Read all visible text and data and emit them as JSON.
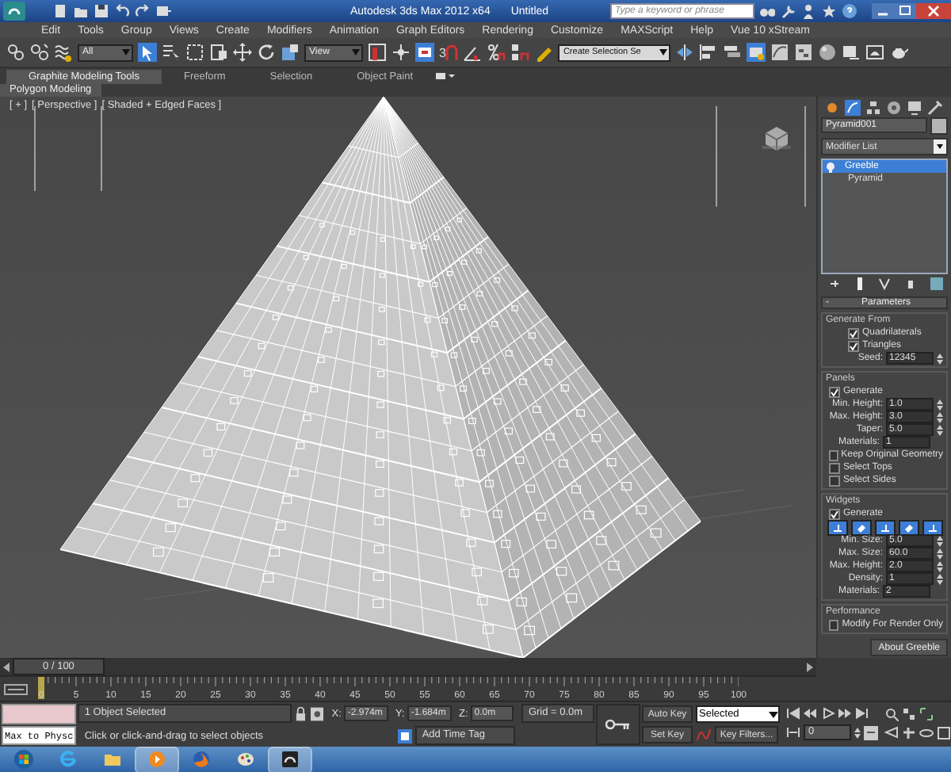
{
  "window": {
    "title": "Autodesk 3ds Max 2012 x64",
    "document": "Untitled",
    "search_placeholder": "Type a keyword or phrase"
  },
  "menu": [
    "Edit",
    "Tools",
    "Group",
    "Views",
    "Create",
    "Modifiers",
    "Animation",
    "Graph Editors",
    "Rendering",
    "Customize",
    "MAXScript",
    "Help",
    "Vue 10 xStream"
  ],
  "toolbar": {
    "selection_filter": "All",
    "reference_coordinate": "View",
    "snap_toggle": "3",
    "named_selection": "Create Selection Se"
  },
  "ribbon": {
    "tabs": [
      {
        "label": "Graphite Modeling Tools",
        "selected": true
      },
      {
        "label": "Freeform",
        "selected": false
      },
      {
        "label": "Selection",
        "selected": false
      },
      {
        "label": "Object Paint",
        "selected": false
      }
    ],
    "panel": "Polygon Modeling"
  },
  "viewport": {
    "labels": [
      "[ + ]",
      "[ Perspective ]",
      "[ Shaded + Edged Faces ]"
    ]
  },
  "command_panel": {
    "object_name": "Pyramid001",
    "modifier_list": "Modifier List",
    "stack": [
      {
        "label": "Greeble",
        "selected": true
      },
      {
        "label": "Pyramid",
        "selected": false
      }
    ],
    "rollout": {
      "toggle": "-",
      "title": "Parameters"
    },
    "groups": [
      {
        "title": "Generate From",
        "rows": [
          {
            "kind": "checkbox",
            "label": "Quadrilaterals",
            "checked": true
          },
          {
            "kind": "checkbox",
            "label": "Triangles",
            "checked": true
          },
          {
            "kind": "spinner",
            "label": "Seed:",
            "value": "12345"
          }
        ]
      },
      {
        "title": "Panels",
        "rows": [
          {
            "kind": "checkbox",
            "label": "Generate",
            "checked": true
          },
          {
            "kind": "spinner",
            "label": "Min. Height:",
            "value": "1.0"
          },
          {
            "kind": "spinner",
            "label": "Max. Height:",
            "value": "3.0"
          },
          {
            "kind": "spinner",
            "label": "Taper:",
            "value": "5.0"
          },
          {
            "kind": "field",
            "label": "Materials:",
            "value": "1"
          },
          {
            "kind": "checkbox",
            "label": "Keep Original Geometry",
            "checked": false
          },
          {
            "kind": "checkbox",
            "label": "Select Tops",
            "checked": false
          },
          {
            "kind": "checkbox",
            "label": "Select Sides",
            "checked": false
          }
        ]
      },
      {
        "title": "Widgets",
        "rows": [
          {
            "kind": "checkbox",
            "label": "Generate",
            "checked": true
          },
          {
            "kind": "buttons",
            "buttons": [
              {
                "selected": true
              },
              {
                "selected": true
              },
              {
                "selected": true
              },
              {
                "selected": true
              },
              {
                "selected": true
              }
            ]
          },
          {
            "kind": "spinner",
            "label": "Min. Size:",
            "value": "5.0"
          },
          {
            "kind": "spinner",
            "label": "Max. Size:",
            "value": "60.0"
          },
          {
            "kind": "spinner",
            "label": "Max. Height:",
            "value": "2.0"
          },
          {
            "kind": "spinner",
            "label": "Density:",
            "value": "1"
          },
          {
            "kind": "field",
            "label": "Materials:",
            "value": "2"
          }
        ]
      },
      {
        "title": "Performance",
        "rows": [
          {
            "kind": "checkbox",
            "label": "Modify For Render Only",
            "checked": false
          }
        ]
      }
    ],
    "about_button": "About Greeble"
  },
  "timeline": {
    "frame": "0 / 100",
    "level": 0,
    "ticks": [
      "0",
      "5",
      "10",
      "15",
      "20",
      "25",
      "30",
      "35",
      "40",
      "45",
      "50",
      "55",
      "60",
      "65",
      "70",
      "75",
      "80",
      "85",
      "90",
      "95",
      "100"
    ]
  },
  "status": {
    "script_field": "Max to Physc",
    "selection": "1 Object Selected",
    "prompt": "Click or click-and-drag to select objects",
    "coordinates": [
      {
        "label": "X:",
        "value": "-2.974m"
      },
      {
        "label": "Y:",
        "value": "-1.684m"
      },
      {
        "label": "Z:",
        "value": "0.0m"
      }
    ],
    "grid": "Grid = 0.0m",
    "time_tag": "Add Time Tag",
    "auto_key": "Auto Key",
    "key_mode": "Selected",
    "set_key": "Set Key",
    "key_filters": "Key Filters...",
    "current_frame": "0"
  },
  "taskbar": {
    "apps": [
      {
        "kind": "start",
        "selected": false
      },
      {
        "kind": "browser",
        "selected": false
      },
      {
        "kind": "folder",
        "selected": false
      },
      {
        "kind": "media",
        "selected": true
      },
      {
        "kind": "firefox",
        "selected": false
      },
      {
        "kind": "paint",
        "selected": false
      },
      {
        "kind": "max",
        "selected": true
      }
    ]
  }
}
